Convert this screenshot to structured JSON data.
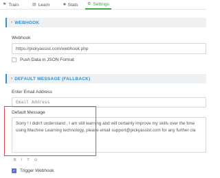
{
  "tabs": [
    {
      "label": "Train",
      "icon": "flag-icon"
    },
    {
      "label": "Learn",
      "icon": "book-icon"
    },
    {
      "label": "Stats",
      "icon": "camera-icon"
    },
    {
      "label": "Settings",
      "icon": "gear-icon",
      "active": true
    }
  ],
  "webhook": {
    "section_title": "WEBHOOK",
    "field_label": "Webhook",
    "url_value": "https://pickyassist.com/webhook.php",
    "json_checkbox_label": "Push Data in JSON Format"
  },
  "default_message": {
    "section_title": "DEFAULT MESSAGE (FALLBACK)",
    "email_label": "Enter Email Address",
    "email_placeholder": "Email Address",
    "message_label": "Default Message",
    "message_line1": "Sorry ! I didn't understand , I am still learning and will certainly improve my skills over the time",
    "message_line2": "using Machine Learning technology, please email support@pickyassist.com for any further cla",
    "format_buttons": [
      "B",
      "/",
      "T",
      "⊙"
    ],
    "trigger_label": "Trigger Webhook"
  },
  "colors": {
    "accent_green": "#3aa845",
    "accent_blue": "#2f8fd8",
    "highlight_red": "#e24848",
    "checkbox_blue": "#5b6ed8"
  }
}
